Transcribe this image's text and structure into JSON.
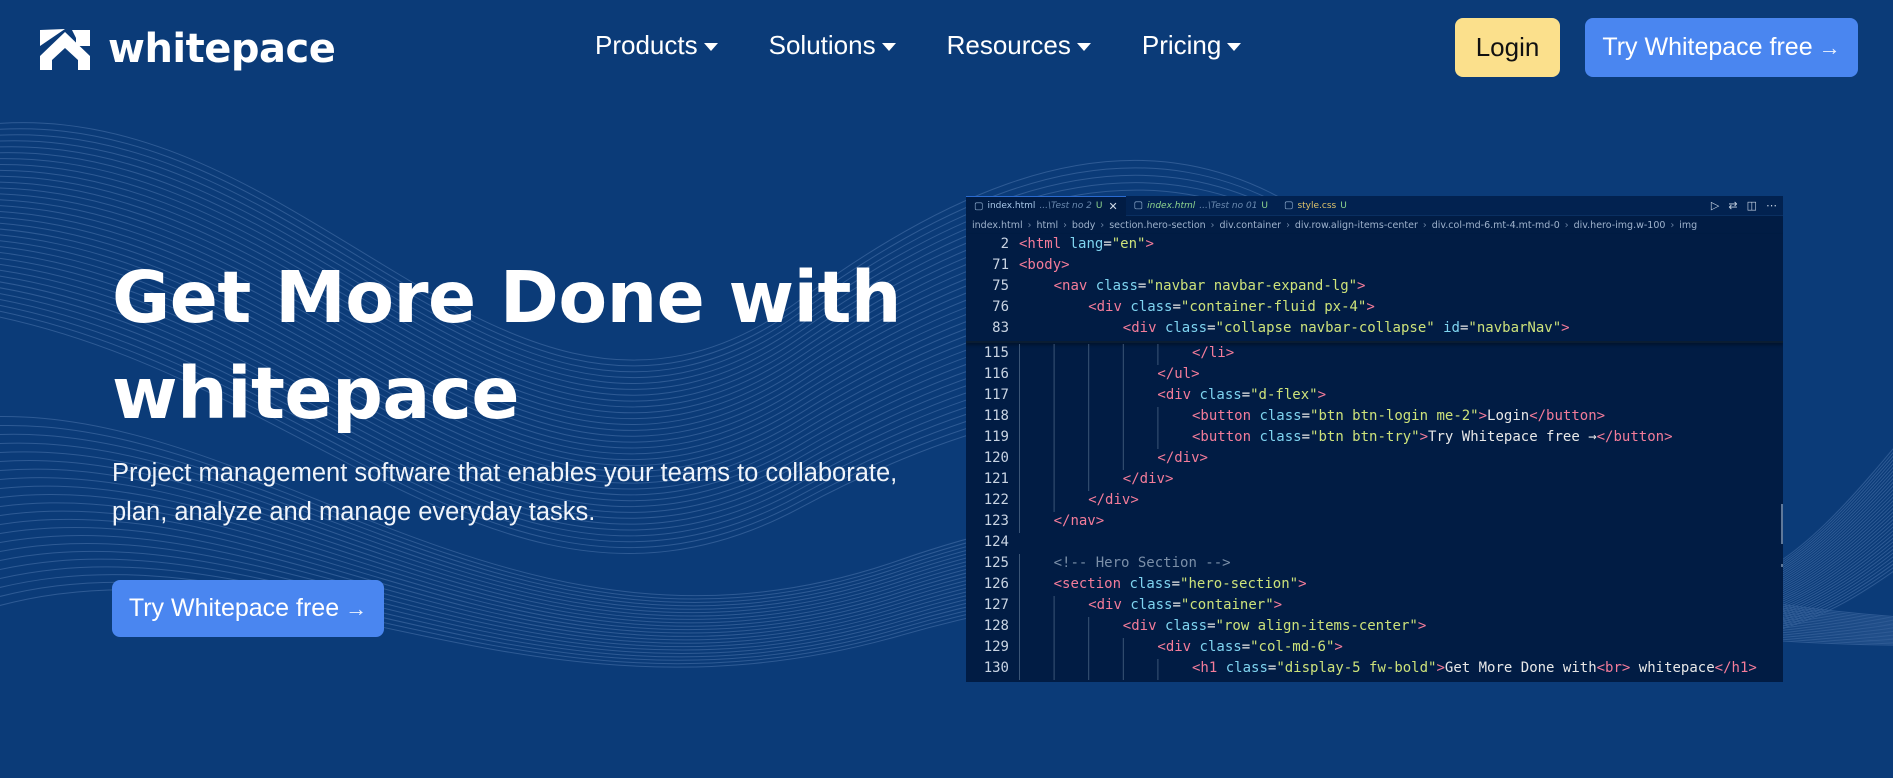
{
  "brand": {
    "name": "whitepace"
  },
  "nav": {
    "items": [
      {
        "label": "Products"
      },
      {
        "label": "Solutions"
      },
      {
        "label": "Resources"
      },
      {
        "label": "Pricing"
      }
    ],
    "login_label": "Login",
    "try_label": "Try Whitepace free"
  },
  "hero": {
    "title_line1": "Get More Done with",
    "title_line2": "whitepace",
    "subtitle_line1": "Project management software that enables your teams to collaborate,",
    "subtitle_line2": "plan, analyze and manage everyday tasks.",
    "cta_label": "Try Whitepace free"
  },
  "editor": {
    "tabs": [
      {
        "name": "index.html",
        "path": "...\\Test no 2",
        "status": "U",
        "active": true
      },
      {
        "name": "index.html",
        "path": "...\\Test no 01",
        "status": "U",
        "active": false
      },
      {
        "name": "style.css",
        "path": "",
        "status": "U",
        "active": false
      }
    ],
    "breadcrumbs": [
      "index.html",
      "html",
      "body",
      "section.hero-section",
      "div.container",
      "div.row.align-items-center",
      "div.col-md-6.mt-4.mt-md-0",
      "div.hero-img.w-100",
      "img"
    ],
    "sticky_lines": [
      {
        "n": "2",
        "indent": 0,
        "code": "<html lang=\"en\">"
      },
      {
        "n": "71",
        "indent": 0,
        "code": "<body>"
      },
      {
        "n": "75",
        "indent": 1,
        "code": "<nav class=\"navbar navbar-expand-lg\">"
      },
      {
        "n": "76",
        "indent": 2,
        "code": "<div class=\"container-fluid px-4\">"
      },
      {
        "n": "83",
        "indent": 3,
        "code": "<div class=\"collapse navbar-collapse\" id=\"navbarNav\">"
      }
    ],
    "lines": [
      {
        "n": "115",
        "indent": 5,
        "code": "</li>"
      },
      {
        "n": "116",
        "indent": 4,
        "code": "</ul>"
      },
      {
        "n": "117",
        "indent": 4,
        "code": "<div class=\"d-flex\">"
      },
      {
        "n": "118",
        "indent": 5,
        "code": "<button class=\"btn btn-login me-2\">Login</button>"
      },
      {
        "n": "119",
        "indent": 5,
        "code": "<button class=\"btn btn-try\">Try Whitepace free →</button>"
      },
      {
        "n": "120",
        "indent": 4,
        "code": "</div>"
      },
      {
        "n": "121",
        "indent": 3,
        "code": "</div>"
      },
      {
        "n": "122",
        "indent": 2,
        "code": "</div>"
      },
      {
        "n": "123",
        "indent": 1,
        "code": "</nav>"
      },
      {
        "n": "124",
        "indent": 0,
        "code": ""
      },
      {
        "n": "125",
        "indent": 1,
        "code": "<!-- Hero Section -->"
      },
      {
        "n": "126",
        "indent": 1,
        "code": "<section class=\"hero-section\">"
      },
      {
        "n": "127",
        "indent": 2,
        "code": "<div class=\"container\">"
      },
      {
        "n": "128",
        "indent": 3,
        "code": "<div class=\"row align-items-center\">"
      },
      {
        "n": "129",
        "indent": 4,
        "code": "<div class=\"col-md-6\">"
      },
      {
        "n": "130",
        "indent": 5,
        "code": "<h1 class=\"display-5 fw-bold\">Get More Done with<br> whitepace</h1>"
      }
    ]
  },
  "colors": {
    "background": "#0b3b78",
    "accent_blue": "#4a86f0",
    "login_yellow": "#fbe08c",
    "editor_bg": "#011c44"
  },
  "icons": {
    "logo": "whitepace-logo-icon",
    "caret": "caret-down-icon",
    "arrow": "arrow-right-icon"
  }
}
